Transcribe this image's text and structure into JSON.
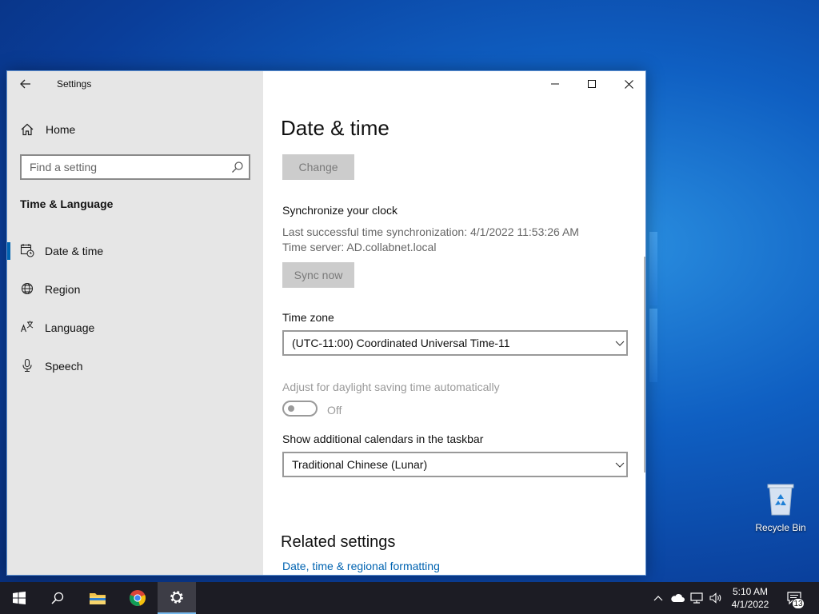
{
  "window": {
    "app_title": "Settings",
    "controls": {
      "minimize": "minimize",
      "maximize": "maximize",
      "close": "close"
    }
  },
  "sidebar": {
    "home_label": "Home",
    "search_placeholder": "Find a setting",
    "section_heading": "Time & Language",
    "items": [
      {
        "label": "Date & time",
        "icon": "calendar-clock-icon",
        "active": true
      },
      {
        "label": "Region",
        "icon": "globe-icon",
        "active": false
      },
      {
        "label": "Language",
        "icon": "language-icon",
        "active": false
      },
      {
        "label": "Speech",
        "icon": "microphone-icon",
        "active": false
      }
    ]
  },
  "main": {
    "page_title": "Date & time",
    "change_button": "Change",
    "sync_heading": "Synchronize your clock",
    "last_sync": "Last successful time synchronization: 4/1/2022 11:53:26 AM",
    "time_server": "Time server: AD.collabnet.local",
    "sync_button": "Sync now",
    "timezone_label": "Time zone",
    "timezone_value": "(UTC-11:00) Coordinated Universal Time-11",
    "dst_label": "Adjust for daylight saving time automatically",
    "dst_toggle_state": "Off",
    "calendars_label": "Show additional calendars in the taskbar",
    "calendars_value": "Traditional Chinese (Lunar)",
    "related_title": "Related settings",
    "related_link": "Date, time & regional formatting"
  },
  "desktop": {
    "recycle_bin_label": "Recycle Bin"
  },
  "taskbar": {
    "time": "5:10 AM",
    "date": "4/1/2022",
    "notification_count": "13"
  },
  "colors": {
    "accent": "#0063b1",
    "sidebar_bg": "#e6e6e6",
    "taskbar_bg": "#1c1c24"
  }
}
